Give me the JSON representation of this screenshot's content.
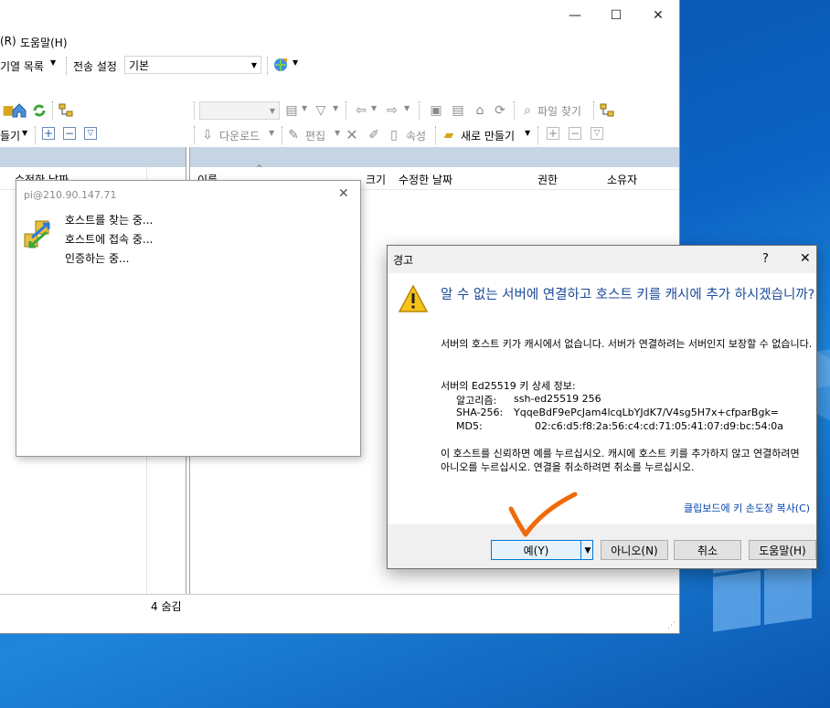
{
  "desktop": {
    "accent": "#0b63c4"
  },
  "window": {
    "controls": {
      "minimize": "—",
      "maximize": "☐",
      "close": "✕"
    },
    "menu": {
      "help_fragment": "(R)",
      "help": "도움말(H)"
    },
    "toolbar1": {
      "queue_fragment": "기열 목록",
      "transfer_settings_label": "전송 설정",
      "transfer_settings_value": "기본"
    },
    "left_toolbar": {
      "make_fragment": "들기"
    },
    "right_toolbar": {
      "find_files": "파일 찾기",
      "download": "다운로드",
      "edit": "편집",
      "properties": "속성",
      "new": "새로 만들기"
    },
    "left_pane": {
      "col_modified": "수정한 날짜",
      "status": "4 숨김"
    },
    "right_pane": {
      "columns": [
        "이름",
        "크기",
        "수정한 날짜",
        "권한",
        "소유자"
      ]
    }
  },
  "connect_popup": {
    "title": "pi@210.90.147.71",
    "steps": [
      "호스트를 찾는 중...",
      "호스트에 접속 중...",
      "인증하는 중..."
    ]
  },
  "warning_dialog": {
    "title": "경고",
    "help_mark": "?",
    "close_mark": "✕",
    "heading": "알 수 없는 서버에 연결하고 호스트 키를 캐시에 추가 하시겠습니까?",
    "para1": "서버의 호스트 키가 캐시에서 없습니다. 서버가 연결하려는 서버인지 보장할 수 없습니다.",
    "detail_title": "서버의 Ed25519 키 상세 정보:",
    "algo_label": "알고리즘:",
    "algo_value": "ssh-ed25519 256",
    "sha_label": "SHA-256:",
    "sha_value": "YqqeBdF9ePcJam4lcqLbYJdK7/V4sg5H7x+cfparBgk=",
    "md5_label": "MD5:",
    "md5_value": "02:c6:d5:f8:2a:56:c4:cd:71:05:41:07:d9:bc:54:0a",
    "para2": "이 호스트를 신뢰하면 예를 누르십시오. 캐시에 호스트 키를 추가하지 않고 연결하려면 아니오를 누르십시오. 연결을 취소하려면 취소를 누르십시오.",
    "clipboard_link": "클립보드에 키 손도장 복사(C)",
    "buttons": {
      "yes": "예(Y)",
      "no": "아니오(N)",
      "cancel": "취소",
      "help": "도움말(H)"
    },
    "link_color": "#0645ad",
    "heading_color": "#1a4a99",
    "annotation_color": "#f06a0c"
  }
}
